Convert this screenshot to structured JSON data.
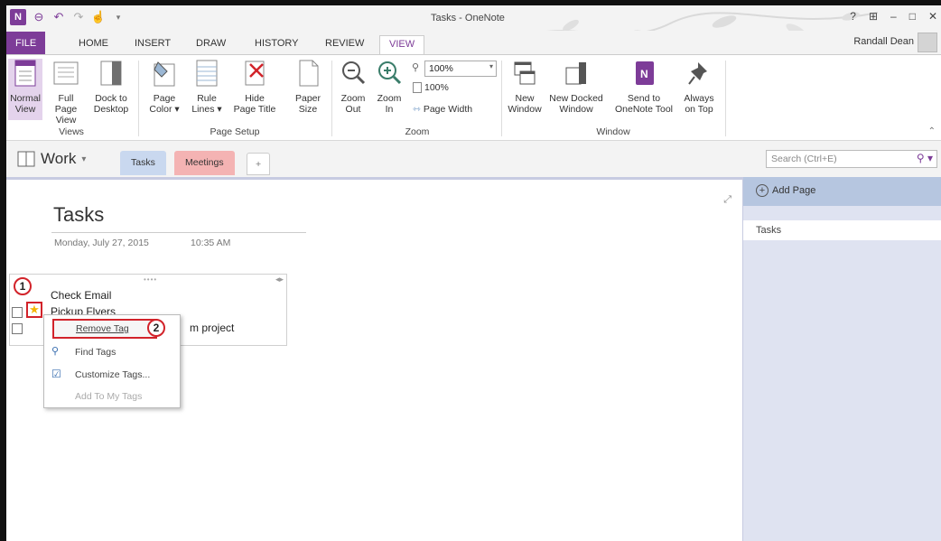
{
  "window": {
    "title": "Tasks - OneNote",
    "user": "Randall Dean",
    "help": "?",
    "minimize": "–",
    "restore": "□",
    "close": "✕"
  },
  "ribbon_tabs": [
    "FILE",
    "HOME",
    "INSERT",
    "DRAW",
    "HISTORY",
    "REVIEW",
    "VIEW"
  ],
  "ribbon": {
    "views": {
      "label": "Views",
      "normal_view": [
        "Normal",
        "View"
      ],
      "full_page_view": [
        "Full Page",
        "View"
      ],
      "dock_to_desktop": [
        "Dock to",
        "Desktop"
      ]
    },
    "page_setup": {
      "label": "Page Setup",
      "page_color": [
        "Page",
        "Color ▾"
      ],
      "rule_lines": [
        "Rule",
        "Lines ▾"
      ],
      "hide_page_title": [
        "Hide",
        "Page Title"
      ],
      "paper_size": [
        "Paper",
        "Size"
      ]
    },
    "zoom": {
      "label": "Zoom",
      "zoom_out": [
        "Zoom",
        "Out"
      ],
      "zoom_in": [
        "Zoom",
        "In"
      ],
      "combo_value": "100%",
      "hundred": "100%",
      "page_width": "Page Width"
    },
    "window_group": {
      "label": "Window",
      "new_window": [
        "New",
        "Window"
      ],
      "new_docked": [
        "New Docked",
        "Window"
      ],
      "send_to_tool": [
        "Send to",
        "OneNote Tool"
      ],
      "always_on_top": [
        "Always",
        "on Top"
      ]
    }
  },
  "notebook": {
    "name": "Work",
    "sections": [
      "Tasks",
      "Meetings",
      "+"
    ],
    "search_placeholder": "Search (Ctrl+E)"
  },
  "page": {
    "title": "Tasks",
    "date": "Monday, July 27, 2015",
    "time": "10:35 AM",
    "notes": [
      "Check Email",
      "Pickup Flyers",
      "m project"
    ]
  },
  "context_menu": {
    "remove_tag": "Remove Tag",
    "find_tags": "Find Tags",
    "customize_tags": "Customize Tags...",
    "add_to_my_tags": "Add To My Tags"
  },
  "markers": [
    "1",
    "2"
  ],
  "pages_pane": {
    "add_page": "Add Page",
    "pages": [
      "Tasks"
    ]
  },
  "colors": {
    "accent": "#7d3c98",
    "highlight": "#d2232a",
    "section_tasks": "#c9d8ef",
    "section_meetings": "#f4b3b3",
    "pane_bg": "#dfe3f1"
  }
}
